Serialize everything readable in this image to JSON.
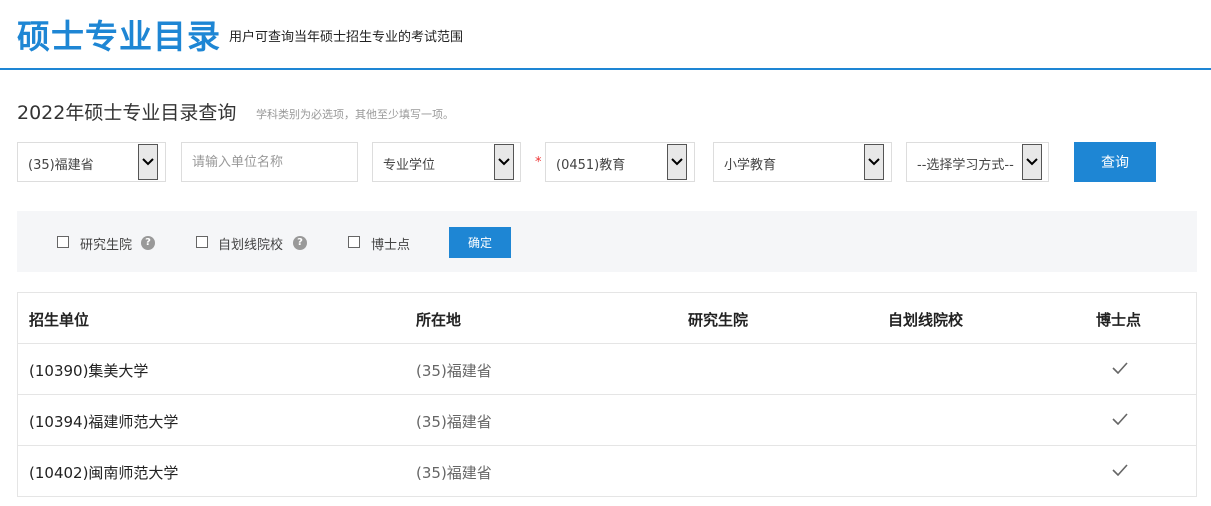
{
  "header": {
    "title": "硕士专业目录",
    "subtitle": "用户可查询当年硕士招生专业的考试范围"
  },
  "query": {
    "title": "2022年硕士专业目录查询",
    "hint": "学科类别为必选项，其他至少填写一项。",
    "province_value": "(35)福建省",
    "unit_placeholder": "请输入单位名称",
    "degree_type_value": "专业学位",
    "required_mark": "*",
    "discipline_value": "(0451)教育",
    "major_value": "小学教育",
    "study_mode_value": "--选择学习方式--",
    "submit_label": "查询"
  },
  "filters": {
    "graduate_school_label": "研究生院",
    "self_line_label": "自划线院校",
    "doctoral_label": "博士点",
    "help_glyph": "?",
    "confirm_label": "确定"
  },
  "table": {
    "headers": [
      "招生单位",
      "所在地",
      "研究生院",
      "自划线院校",
      "博士点"
    ],
    "rows": [
      {
        "unit": "(10390)集美大学",
        "location": "(35)福建省",
        "graduate_school": false,
        "self_line": false,
        "doctoral": true
      },
      {
        "unit": "(10394)福建师范大学",
        "location": "(35)福建省",
        "graduate_school": false,
        "self_line": false,
        "doctoral": true
      },
      {
        "unit": "(10402)闽南师范大学",
        "location": "(35)福建省",
        "graduate_school": false,
        "self_line": false,
        "doctoral": true
      }
    ]
  },
  "colors": {
    "brand": "#1e86d4",
    "required": "#e33333",
    "filter_bg": "#f5f6f8"
  },
  "icons": {
    "select_arrow": "chevron-down-icon",
    "help": "help-icon",
    "check": "check-icon"
  }
}
